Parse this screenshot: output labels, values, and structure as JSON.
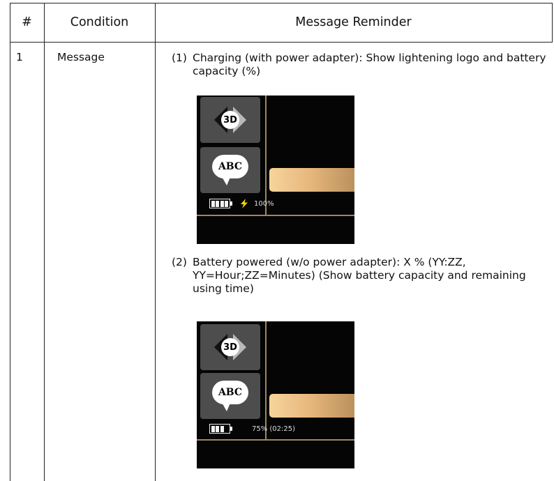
{
  "table": {
    "headers": [
      "#",
      "Condition",
      "Message Reminder"
    ],
    "row": {
      "number": "1",
      "condition": "Message",
      "items": [
        {
          "marker": "(1)",
          "text": "Charging (with power adapter): Show lightening logo and battery capacity (%)",
          "screen": {
            "icon_3d_label": "3D",
            "icon_abc_label": "ABC",
            "battery_fill_fraction": 1.0,
            "lightning_icon": "lightning-bolt-icon",
            "status_text": "100%"
          }
        },
        {
          "marker": "(2)",
          "text": "Battery powered (w/o power adapter): X % (YY:ZZ, YY=Hour;ZZ=Minutes) (Show battery capacity and remaining using time)",
          "screen": {
            "icon_3d_label": "3D",
            "icon_abc_label": "ABC",
            "battery_fill_fraction": 0.75,
            "status_text": "75% (02:25)"
          }
        }
      ]
    }
  },
  "colors": {
    "screen_bg": "#050505",
    "tile_bg": "#4d4d4d",
    "accent_gold": "#e6b77d",
    "divider": "#a08660",
    "lightning": "#f5d800"
  }
}
